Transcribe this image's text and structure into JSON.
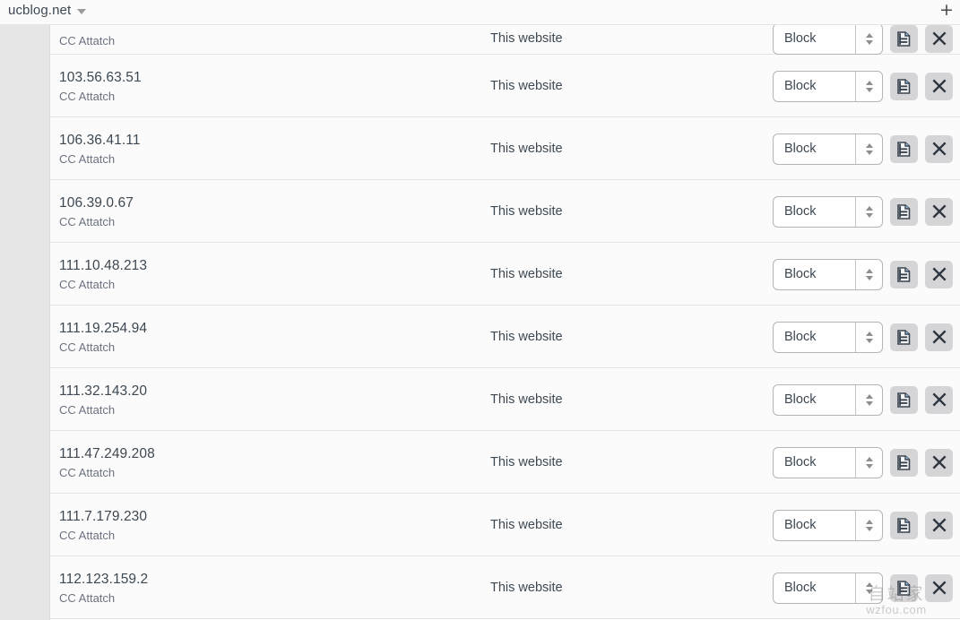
{
  "topbar": {
    "site_name": "ucblog.net",
    "caret_icon": "chevron-down-icon",
    "add_label": "+"
  },
  "table": {
    "scope_default": "This website",
    "note_default": "CC Attatch",
    "action_default": "Block",
    "report_icon": "document-icon",
    "delete_icon": "close-x-icon",
    "rows": [
      {
        "ip": "",
        "note": "CC Attatch",
        "scope": "This website",
        "action": "Block",
        "partial": true
      },
      {
        "ip": "103.56.63.51",
        "note": "CC Attatch",
        "scope": "This website",
        "action": "Block",
        "partial": false
      },
      {
        "ip": "106.36.41.11",
        "note": "CC Attatch",
        "scope": "This website",
        "action": "Block",
        "partial": false
      },
      {
        "ip": "106.39.0.67",
        "note": "CC Attatch",
        "scope": "This website",
        "action": "Block",
        "partial": false
      },
      {
        "ip": "111.10.48.213",
        "note": "CC Attatch",
        "scope": "This website",
        "action": "Block",
        "partial": false
      },
      {
        "ip": "111.19.254.94",
        "note": "CC Attatch",
        "scope": "This website",
        "action": "Block",
        "partial": false
      },
      {
        "ip": "111.32.143.20",
        "note": "CC Attatch",
        "scope": "This website",
        "action": "Block",
        "partial": false
      },
      {
        "ip": "111.47.249.208",
        "note": "CC Attatch",
        "scope": "This website",
        "action": "Block",
        "partial": false
      },
      {
        "ip": "111.7.179.230",
        "note": "CC Attatch",
        "scope": "This website",
        "action": "Block",
        "partial": false
      },
      {
        "ip": "112.123.159.2",
        "note": "CC Attatch",
        "scope": "This website",
        "action": "Block",
        "partial": false
      }
    ]
  },
  "watermark": {
    "cn_text": "自站家",
    "url_text": "wzfou.com"
  },
  "colors": {
    "page_bg": "#e6e6e6",
    "panel_bg": "#fbfbfb",
    "row_border": "#e4e4e4",
    "text_primary": "#3d4852",
    "text_secondary": "#6b7280",
    "button_bg": "#d5d5d7"
  }
}
